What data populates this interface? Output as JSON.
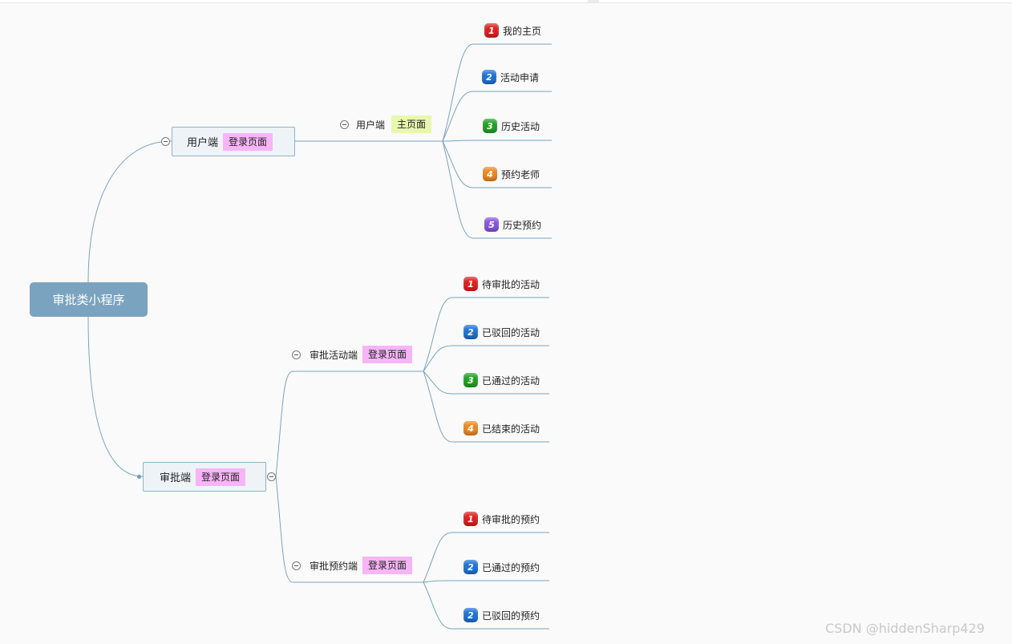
{
  "central": {
    "label": "审批类小程序"
  },
  "user_branch": {
    "label": "用户端",
    "tag": "登录页面",
    "sub": {
      "label": "用户端",
      "tag": "主页面"
    },
    "leaves": [
      {
        "num": "1",
        "label": "我的主页"
      },
      {
        "num": "2",
        "label": "活动申请"
      },
      {
        "num": "3",
        "label": "历史活动"
      },
      {
        "num": "4",
        "label": "预约老师"
      },
      {
        "num": "5",
        "label": "历史预约"
      }
    ]
  },
  "approval_branch": {
    "label": "审批端",
    "tag": "登录页面",
    "activity": {
      "label": "审批活动端",
      "tag": "登录页面",
      "leaves": [
        {
          "num": "1",
          "label": "待审批的活动"
        },
        {
          "num": "2",
          "label": "已驳回的活动"
        },
        {
          "num": "3",
          "label": "已通过的活动"
        },
        {
          "num": "4",
          "label": "已结束的活动"
        }
      ]
    },
    "booking": {
      "label": "审批预约端",
      "tag": "登录页面",
      "leaves": [
        {
          "num": "1",
          "label": "待审批的预约"
        },
        {
          "num": "2",
          "label": "已通过的预约"
        },
        {
          "num": "2",
          "label": "已驳回的预约"
        }
      ]
    }
  },
  "watermark": "CSDN @hiddenSharp429",
  "colors": {
    "central": "#7aa3bf",
    "connector": "#7aa3bf",
    "pink_tag": "#f7b5f7",
    "green_tag": "#e8f7b0",
    "badge_1": "#e02020",
    "badge_2": "#1f74d6",
    "badge_3": "#23a323",
    "badge_4": "#ef8a23",
    "badge_5": "#8a56e0"
  }
}
